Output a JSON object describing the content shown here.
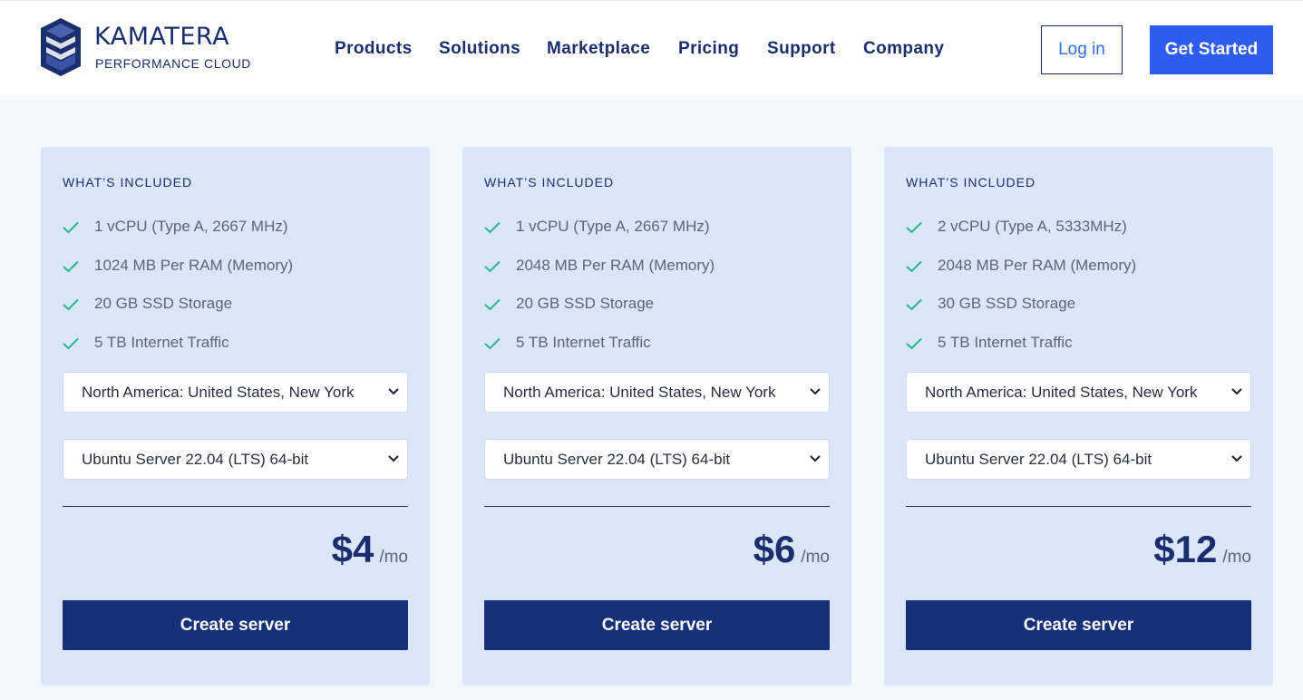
{
  "brand": {
    "name": "KAMATERA",
    "tagline": "PERFORMANCE CLOUD"
  },
  "nav": {
    "items": [
      {
        "label": "Products"
      },
      {
        "label": "Solutions"
      },
      {
        "label": "Marketplace"
      },
      {
        "label": "Pricing"
      },
      {
        "label": "Support"
      },
      {
        "label": "Company"
      }
    ],
    "login_label": "Log in",
    "start_label": "Get Started"
  },
  "colors": {
    "brand_navy": "#1b2f6e",
    "accent_blue": "#2f5cf0",
    "check_green": "#27b88a",
    "card_bg": "#dce6fb"
  },
  "icons": {
    "feature": "check-icon",
    "dropdown": "chevron-down-icon"
  },
  "plans": [
    {
      "heading": "WHAT’S INCLUDED",
      "features": [
        "1 vCPU (Type A, 2667 MHz)",
        "1024 MB Per RAM (Memory)",
        "20 GB SSD Storage",
        "5 TB Internet Traffic"
      ],
      "location": "North America: United States, New York, New York",
      "os": "Ubuntu Server 22.04 (LTS) 64-bit",
      "price": "$4",
      "period": "/mo",
      "cta": "Create server"
    },
    {
      "heading": "WHAT’S INCLUDED",
      "features": [
        "1 vCPU (Type A, 2667 MHz)",
        "2048 MB Per RAM (Memory)",
        "20 GB SSD Storage",
        "5 TB Internet Traffic"
      ],
      "location": "North America: United States, New York, New York",
      "os": "Ubuntu Server 22.04 (LTS) 64-bit",
      "price": "$6",
      "period": "/mo",
      "cta": "Create server"
    },
    {
      "heading": "WHAT’S INCLUDED",
      "features": [
        "2 vCPU (Type A, 5333MHz)",
        "2048 MB Per RAM (Memory)",
        "30 GB SSD Storage",
        "5 TB Internet Traffic"
      ],
      "location": "North America: United States, New York, New York",
      "os": "Ubuntu Server 22.04 (LTS) 64-bit",
      "price": "$12",
      "period": "/mo",
      "cta": "Create server"
    }
  ]
}
